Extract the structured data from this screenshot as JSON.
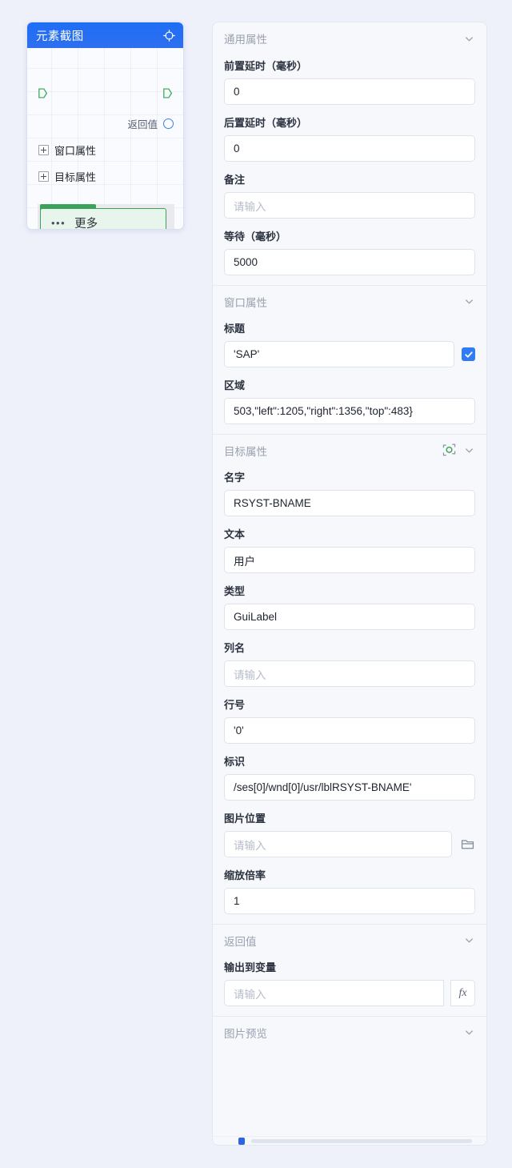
{
  "node": {
    "title": "元素截图",
    "header_icon": "crosshair-target-icon",
    "return_label": "返回值",
    "tree": [
      {
        "label": "窗口属性"
      },
      {
        "label": "目标属性"
      }
    ],
    "more_button": {
      "dots": "•••",
      "label": "更多"
    }
  },
  "panel": {
    "sections": [
      {
        "title": "通用属性",
        "fields": [
          {
            "label": "前置延时（毫秒）",
            "value": "0",
            "placeholder": ""
          },
          {
            "label": "后置延时（毫秒）",
            "value": "0",
            "placeholder": ""
          },
          {
            "label": "备注",
            "value": "",
            "placeholder": "请输入"
          },
          {
            "label": "等待（毫秒）",
            "value": "5000",
            "placeholder": ""
          }
        ]
      },
      {
        "title": "窗口属性",
        "fields": [
          {
            "label": "标题",
            "value": "'SAP'",
            "placeholder": "",
            "checkbox": true
          },
          {
            "label": "区域",
            "value": "503,\"left\":1205,\"right\":1356,\"top\":483}",
            "placeholder": ""
          }
        ]
      },
      {
        "title": "目标属性",
        "head_icon": "capture-element-icon",
        "fields": [
          {
            "label": "名字",
            "value": "RSYST-BNAME",
            "placeholder": ""
          },
          {
            "label": "文本",
            "value": "用户",
            "placeholder": ""
          },
          {
            "label": "类型",
            "value": "GuiLabel",
            "placeholder": ""
          },
          {
            "label": "列名",
            "value": "",
            "placeholder": "请输入"
          },
          {
            "label": "行号",
            "value": "'0'",
            "placeholder": ""
          },
          {
            "label": "标识",
            "value": "/ses[0]/wnd[0]/usr/lblRSYST-BNAME'",
            "placeholder": ""
          },
          {
            "label": "图片位置",
            "value": "",
            "placeholder": "请输入",
            "folder": true
          },
          {
            "label": "缩放倍率",
            "value": "1",
            "placeholder": ""
          }
        ]
      },
      {
        "title": "返回值",
        "fields": [
          {
            "label": "输出到变量",
            "value": "",
            "placeholder": "请输入",
            "fx": "fx"
          }
        ]
      },
      {
        "title": "图片预览",
        "fields": []
      }
    ]
  },
  "colors": {
    "background": "#eef1fa",
    "node_header": "#2f6ff0",
    "accent_green": "#3aa259",
    "checkbox_blue": "#2f7cf6",
    "panel_bg": "#f7f8fb"
  }
}
